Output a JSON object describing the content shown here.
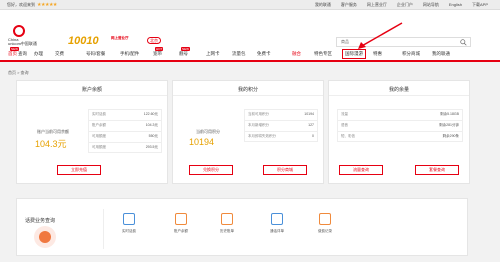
{
  "topbar": {
    "greeting": "您好，欢迎来到",
    "stars": "★★★★★",
    "links": [
      "我的联通",
      "客户服务",
      "网上营业厅",
      "企业门户",
      "网站导航",
      "English"
    ],
    "app": "下载APP"
  },
  "header": {
    "logo_text": "China\nunicom中国联通",
    "hotline": "10010",
    "hotline_sub": "网上营业厅",
    "province": "北京",
    "search": {
      "value": "商品",
      "placeholder": ""
    }
  },
  "nav": {
    "items": [
      {
        "label": "首页",
        "badge": "NEW",
        "active": true
      },
      {
        "label": "查询"
      },
      {
        "label": "办理"
      },
      {
        "label": "交费"
      },
      {
        "label": "号码/套餐"
      },
      {
        "label": "手机/配件"
      },
      {
        "label": "宽带",
        "badge": "HOT"
      },
      {
        "label": "靓号",
        "badge": "NEW"
      },
      {
        "label": "上网卡"
      },
      {
        "label": "流量包"
      },
      {
        "label": "免费卡"
      },
      {
        "label": "融合",
        "active": true
      },
      {
        "label": "特色专区"
      },
      {
        "label": "国际漫游",
        "boxed": true
      },
      {
        "label": "特惠"
      },
      {
        "label": "积分商城"
      },
      {
        "label": "我的联通"
      }
    ]
  },
  "breadcrumb": "首页 > 查询",
  "cards": [
    {
      "title": "账户余额",
      "big_label": "账户当前可用余额",
      "big_value": "104.3元",
      "rows": [
        {
          "label": "实时话费",
          "value": "122.60元"
        },
        {
          "label": "账户余额",
          "value": "104.3元"
        },
        {
          "label": "可用额度",
          "value": "550元"
        },
        {
          "label": "可用额度",
          "value": "293.5元"
        }
      ],
      "button": "立即充值"
    },
    {
      "title": "我的积分",
      "big_label": "当前可用积分",
      "big_value": "10194",
      "rows": [
        {
          "label": "当前可用积分",
          "value": "10194"
        },
        {
          "label": "本月新增积分",
          "value": "127"
        },
        {
          "label": "本月即将失效积分",
          "value": "0"
        }
      ],
      "buttons": [
        "兑换积分",
        "积分商城"
      ]
    },
    {
      "title": "我的余量",
      "rows": [
        {
          "label": "流量",
          "value": "剩余5.18GB"
        },
        {
          "label": "语音",
          "value": "剩余281分钟"
        },
        {
          "label": "短、彩信",
          "value": "剩余290条"
        }
      ],
      "buttons": [
        "流量查询",
        "套餐查询"
      ]
    }
  ],
  "bottom": {
    "lead": "话费业务查询",
    "quick": [
      {
        "label": "实时话费",
        "color": "#4a90d9"
      },
      {
        "label": "账户余额",
        "color": "#f08a3c"
      },
      {
        "label": "历史账单",
        "color": "#f08a3c"
      },
      {
        "label": "通话详单",
        "color": "#4a90d9"
      },
      {
        "label": "缴费记录",
        "color": "#f08a3c"
      }
    ]
  },
  "colors": {
    "brand": "#e60012",
    "accent": "#e6a100"
  }
}
